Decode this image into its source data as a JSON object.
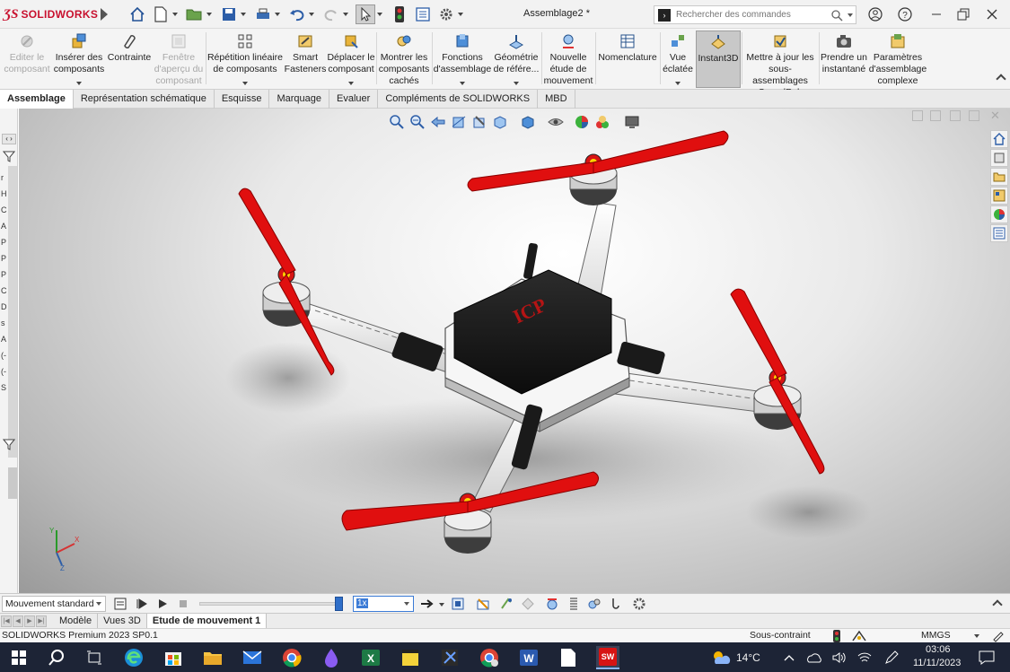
{
  "app": {
    "brand": "SOLIDWORKS",
    "document_title": "Assemblage2 *"
  },
  "quick_access": {
    "icons": [
      "home-icon",
      "new-document-icon",
      "open-icon",
      "save-icon",
      "print-icon",
      "undo-icon",
      "redo-icon",
      "select-icon",
      "rebuild-icon",
      "file-properties-icon",
      "options-icon"
    ]
  },
  "search": {
    "placeholder": "Rechercher des commandes"
  },
  "ribbon": {
    "buttons": [
      {
        "label": "Editer le composant",
        "icon": "edit-component-icon",
        "disabled": true
      },
      {
        "label": "Insérer des composants",
        "icon": "insert-components-icon",
        "disabled": false
      },
      {
        "label": "Contrainte",
        "icon": "mate-icon",
        "disabled": false
      },
      {
        "label": "Fenêtre d'aperçu du composant",
        "icon": "preview-window-icon",
        "disabled": true
      },
      {
        "label": "Répétition linéaire de composants",
        "icon": "linear-pattern-icon",
        "disabled": false
      },
      {
        "label": "Smart Fasteners",
        "icon": "smart-fasteners-icon",
        "disabled": false
      },
      {
        "label": "Déplacer le composant",
        "icon": "move-component-icon",
        "disabled": false
      },
      {
        "label": "Montrer les composants cachés",
        "icon": "show-hidden-icon",
        "disabled": false
      },
      {
        "label": "Fonctions d'assemblage",
        "icon": "assembly-features-icon",
        "disabled": false
      },
      {
        "label": "Géométrie de référe...",
        "icon": "reference-geometry-icon",
        "disabled": false
      },
      {
        "label": "Nouvelle étude de mouvement",
        "icon": "motion-study-icon",
        "disabled": false
      },
      {
        "label": "Nomenclature",
        "icon": "bill-of-materials-icon",
        "disabled": false
      },
      {
        "label": "Vue éclatée",
        "icon": "exploded-view-icon",
        "disabled": false
      },
      {
        "label": "Instant3D",
        "icon": "instant3d-icon",
        "disabled": false,
        "active": true
      },
      {
        "label": "Mettre à jour les sous-assemblages SpeedPak",
        "icon": "speedpak-icon",
        "disabled": false
      },
      {
        "label": "Prendre un instantané",
        "icon": "snapshot-icon",
        "disabled": false
      },
      {
        "label": "Paramètres d'assemblage complexe",
        "icon": "large-assembly-icon",
        "disabled": false
      }
    ]
  },
  "command_tabs": [
    "Assemblage",
    "Représentation schématique",
    "Esquisse",
    "Marquage",
    "Evaluer",
    "Compléments de SOLIDWORKS",
    "MBD"
  ],
  "left_panel_letters": [
    "r",
    "H",
    "C",
    "A",
    "P",
    "P",
    "P",
    "C",
    "D",
    "s",
    "A",
    "(-",
    "(-",
    "S"
  ],
  "model": {
    "lid_text": "ICP",
    "colors": {
      "propeller": "#e00f0f",
      "frame": "#f4f4f4",
      "lid": "#151515",
      "lid_text": "#b51414",
      "motor_cap": "#ffd400"
    }
  },
  "triad": {
    "x": "X",
    "y": "Y",
    "z": "Z"
  },
  "motion_study": {
    "type": "Mouvement standard",
    "speed": "1x",
    "time_fraction": 0.97
  },
  "document_tabs": [
    "Modèle",
    "Vues 3D",
    "Etude de mouvement 1"
  ],
  "status": {
    "version": "SOLIDWORKS Premium 2023 SP0.1",
    "definition": "Sous-contraint",
    "units": "MMGS"
  },
  "taskbar": {
    "temperature": "14°C",
    "time": "03:06",
    "date": "11/11/2023"
  }
}
